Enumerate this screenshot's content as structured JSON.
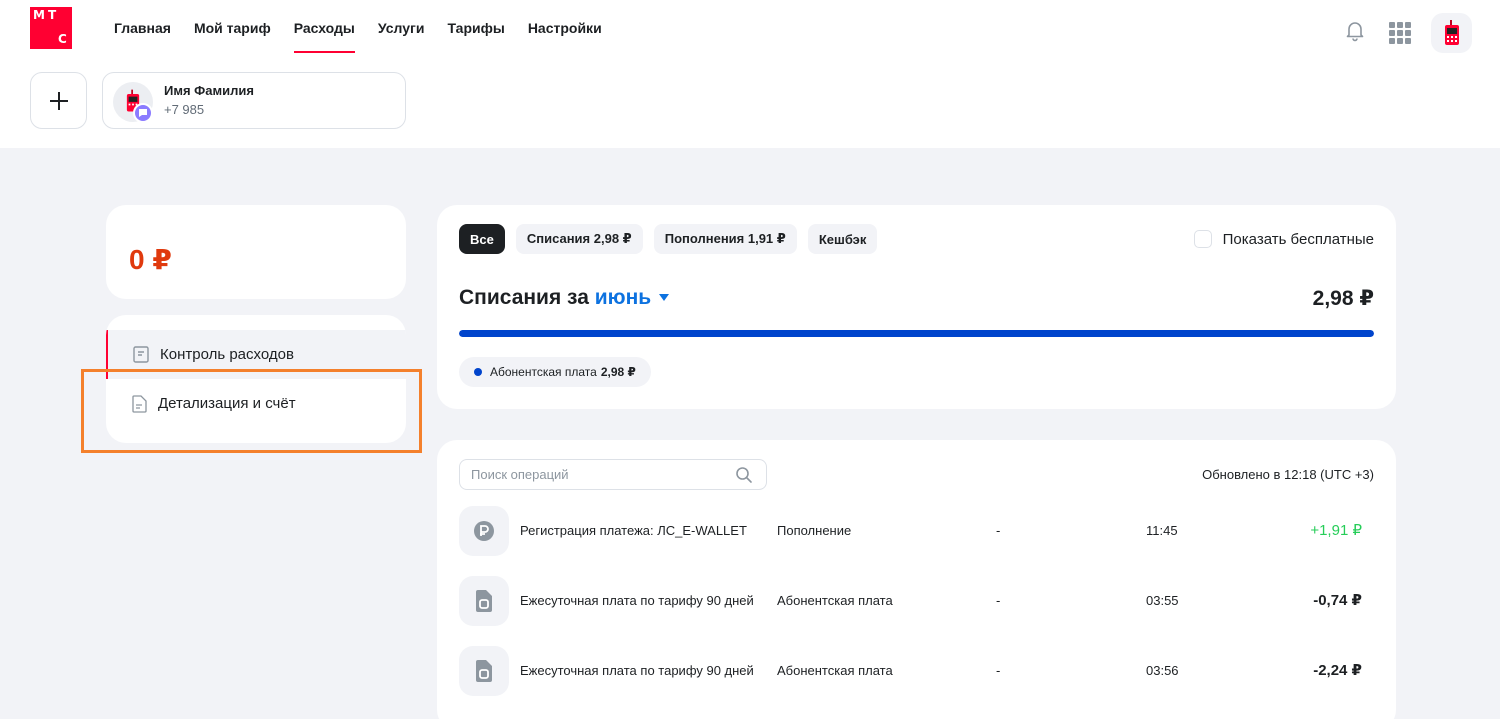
{
  "logo": {
    "letters": [
      "М",
      "Т",
      "С"
    ],
    "brand_color": "#ff0032"
  },
  "nav": {
    "items": [
      {
        "label": "Главная"
      },
      {
        "label": "Мой тариф"
      },
      {
        "label": "Расходы",
        "active": true
      },
      {
        "label": "Услуги"
      },
      {
        "label": "Тарифы"
      },
      {
        "label": "Настройки"
      }
    ]
  },
  "header_icons": [
    "bell-icon",
    "apps-grid-icon",
    "phone-avatar-icon"
  ],
  "account": {
    "name": "Имя Фамилия",
    "phone": "+7 985"
  },
  "balance": {
    "value": "0 ₽",
    "color": "#e03a0e"
  },
  "side_menu": {
    "items": [
      {
        "label": "Контроль расходов",
        "active": true,
        "icon": "receipt-icon"
      },
      {
        "label": "Детализация и счёт",
        "icon": "document-icon"
      }
    ]
  },
  "filters": {
    "chips": [
      {
        "label": "Все",
        "active": true
      },
      {
        "label": "Списания 2,98 ₽"
      },
      {
        "label": "Пополнения 1,91 ₽"
      },
      {
        "label": "Кешбэк"
      }
    ],
    "show_free_label": "Показать бесплатные",
    "show_free_checked": false
  },
  "spending": {
    "title_prefix": "Списания за",
    "month": "июнь",
    "total": "2,98 ₽",
    "progress_fraction": 1.0,
    "bar_color": "#0044cc",
    "legend": {
      "label": "Абонентская плата",
      "value": "2,98 ₽"
    }
  },
  "operations": {
    "search_placeholder": "Поиск операций",
    "updated": "Обновлено в 12:18 (UTC +3)",
    "rows": [
      {
        "title": "Регистрация платежа: ЛС_E-WALLET",
        "type": "Пополнение",
        "dash": "-",
        "time": "11:45",
        "amount": "+1,91 ₽",
        "positive": true,
        "icon": "payment-icon"
      },
      {
        "title": "Ежесуточная плата по тарифу 90 дней",
        "type": "Абонентская плата",
        "dash": "-",
        "time": "03:55",
        "amount": "-0,74 ₽",
        "positive": false,
        "icon": "sim-card-icon"
      },
      {
        "title": "Ежесуточная плата по тарифу 90 дней",
        "type": "Абонентская плата",
        "dash": "-",
        "time": "03:56",
        "amount": "-2,24 ₽",
        "positive": false,
        "icon": "sim-card-icon"
      }
    ]
  }
}
